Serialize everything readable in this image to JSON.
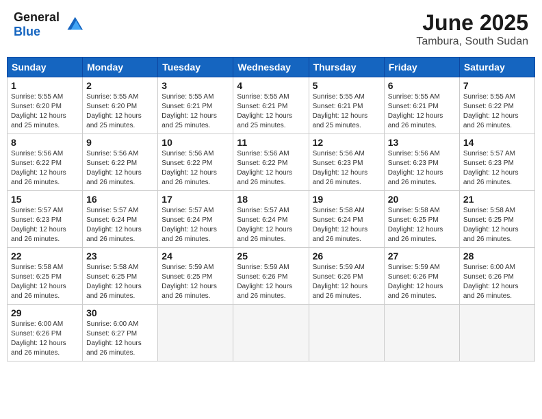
{
  "header": {
    "logo_general": "General",
    "logo_blue": "Blue",
    "month_title": "June 2025",
    "subtitle": "Tambura, South Sudan"
  },
  "days_of_week": [
    "Sunday",
    "Monday",
    "Tuesday",
    "Wednesday",
    "Thursday",
    "Friday",
    "Saturday"
  ],
  "weeks": [
    [
      {
        "day": 1,
        "info": "Sunrise: 5:55 AM\nSunset: 6:20 PM\nDaylight: 12 hours\nand 25 minutes."
      },
      {
        "day": 2,
        "info": "Sunrise: 5:55 AM\nSunset: 6:20 PM\nDaylight: 12 hours\nand 25 minutes."
      },
      {
        "day": 3,
        "info": "Sunrise: 5:55 AM\nSunset: 6:21 PM\nDaylight: 12 hours\nand 25 minutes."
      },
      {
        "day": 4,
        "info": "Sunrise: 5:55 AM\nSunset: 6:21 PM\nDaylight: 12 hours\nand 25 minutes."
      },
      {
        "day": 5,
        "info": "Sunrise: 5:55 AM\nSunset: 6:21 PM\nDaylight: 12 hours\nand 25 minutes."
      },
      {
        "day": 6,
        "info": "Sunrise: 5:55 AM\nSunset: 6:21 PM\nDaylight: 12 hours\nand 26 minutes."
      },
      {
        "day": 7,
        "info": "Sunrise: 5:55 AM\nSunset: 6:22 PM\nDaylight: 12 hours\nand 26 minutes."
      }
    ],
    [
      {
        "day": 8,
        "info": "Sunrise: 5:56 AM\nSunset: 6:22 PM\nDaylight: 12 hours\nand 26 minutes."
      },
      {
        "day": 9,
        "info": "Sunrise: 5:56 AM\nSunset: 6:22 PM\nDaylight: 12 hours\nand 26 minutes."
      },
      {
        "day": 10,
        "info": "Sunrise: 5:56 AM\nSunset: 6:22 PM\nDaylight: 12 hours\nand 26 minutes."
      },
      {
        "day": 11,
        "info": "Sunrise: 5:56 AM\nSunset: 6:22 PM\nDaylight: 12 hours\nand 26 minutes."
      },
      {
        "day": 12,
        "info": "Sunrise: 5:56 AM\nSunset: 6:23 PM\nDaylight: 12 hours\nand 26 minutes."
      },
      {
        "day": 13,
        "info": "Sunrise: 5:56 AM\nSunset: 6:23 PM\nDaylight: 12 hours\nand 26 minutes."
      },
      {
        "day": 14,
        "info": "Sunrise: 5:57 AM\nSunset: 6:23 PM\nDaylight: 12 hours\nand 26 minutes."
      }
    ],
    [
      {
        "day": 15,
        "info": "Sunrise: 5:57 AM\nSunset: 6:23 PM\nDaylight: 12 hours\nand 26 minutes."
      },
      {
        "day": 16,
        "info": "Sunrise: 5:57 AM\nSunset: 6:24 PM\nDaylight: 12 hours\nand 26 minutes."
      },
      {
        "day": 17,
        "info": "Sunrise: 5:57 AM\nSunset: 6:24 PM\nDaylight: 12 hours\nand 26 minutes."
      },
      {
        "day": 18,
        "info": "Sunrise: 5:57 AM\nSunset: 6:24 PM\nDaylight: 12 hours\nand 26 minutes."
      },
      {
        "day": 19,
        "info": "Sunrise: 5:58 AM\nSunset: 6:24 PM\nDaylight: 12 hours\nand 26 minutes."
      },
      {
        "day": 20,
        "info": "Sunrise: 5:58 AM\nSunset: 6:25 PM\nDaylight: 12 hours\nand 26 minutes."
      },
      {
        "day": 21,
        "info": "Sunrise: 5:58 AM\nSunset: 6:25 PM\nDaylight: 12 hours\nand 26 minutes."
      }
    ],
    [
      {
        "day": 22,
        "info": "Sunrise: 5:58 AM\nSunset: 6:25 PM\nDaylight: 12 hours\nand 26 minutes."
      },
      {
        "day": 23,
        "info": "Sunrise: 5:58 AM\nSunset: 6:25 PM\nDaylight: 12 hours\nand 26 minutes."
      },
      {
        "day": 24,
        "info": "Sunrise: 5:59 AM\nSunset: 6:25 PM\nDaylight: 12 hours\nand 26 minutes."
      },
      {
        "day": 25,
        "info": "Sunrise: 5:59 AM\nSunset: 6:26 PM\nDaylight: 12 hours\nand 26 minutes."
      },
      {
        "day": 26,
        "info": "Sunrise: 5:59 AM\nSunset: 6:26 PM\nDaylight: 12 hours\nand 26 minutes."
      },
      {
        "day": 27,
        "info": "Sunrise: 5:59 AM\nSunset: 6:26 PM\nDaylight: 12 hours\nand 26 minutes."
      },
      {
        "day": 28,
        "info": "Sunrise: 6:00 AM\nSunset: 6:26 PM\nDaylight: 12 hours\nand 26 minutes."
      }
    ],
    [
      {
        "day": 29,
        "info": "Sunrise: 6:00 AM\nSunset: 6:26 PM\nDaylight: 12 hours\nand 26 minutes."
      },
      {
        "day": 30,
        "info": "Sunrise: 6:00 AM\nSunset: 6:27 PM\nDaylight: 12 hours\nand 26 minutes."
      },
      {
        "day": null
      },
      {
        "day": null
      },
      {
        "day": null
      },
      {
        "day": null
      },
      {
        "day": null
      }
    ]
  ]
}
